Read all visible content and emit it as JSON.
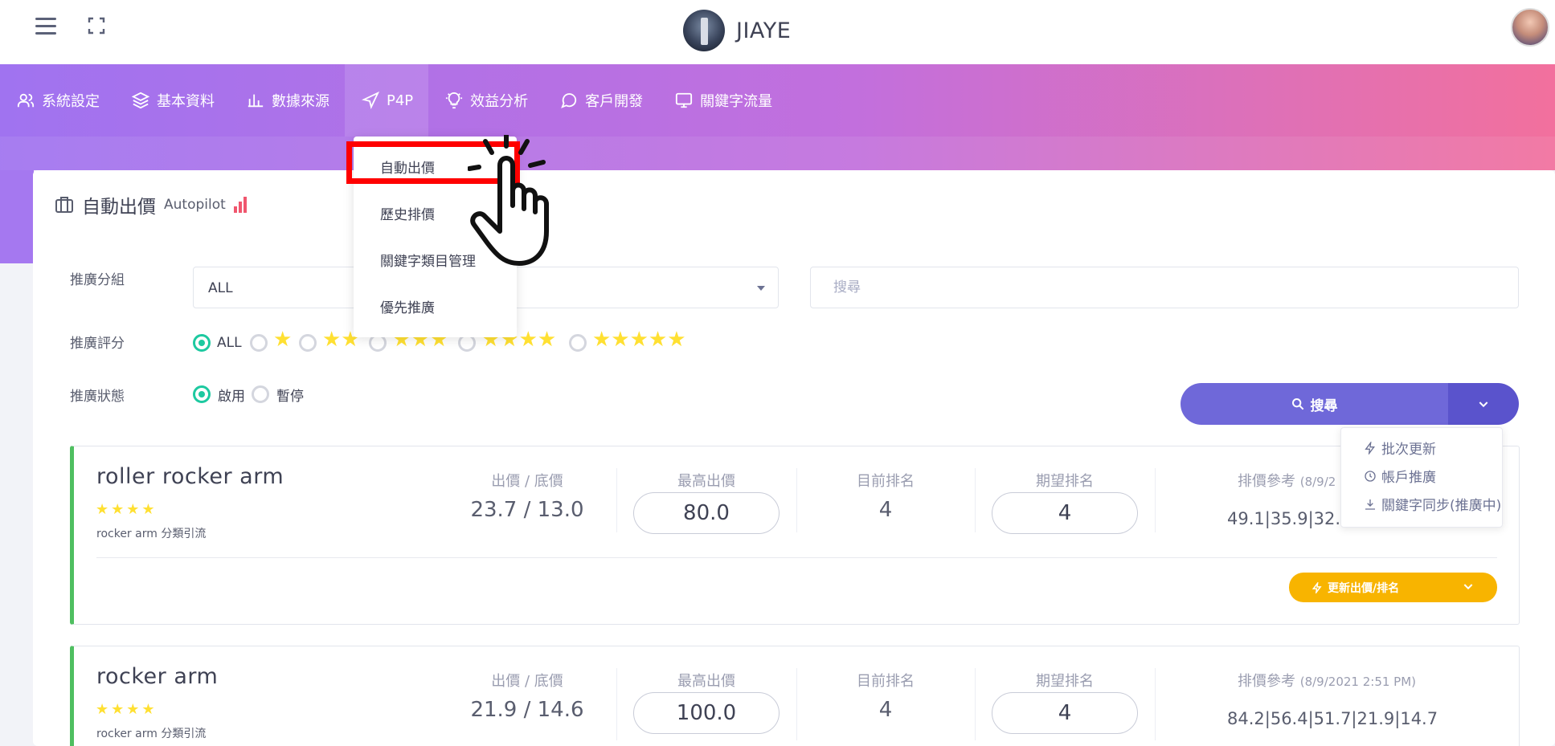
{
  "header": {
    "brand_name": "JIAYE",
    "menu_icon": "hamburger-icon",
    "fullscreen_icon": "expand-icon",
    "avatar_icon": "user-avatar"
  },
  "nav": {
    "items": [
      {
        "label": "系統設定",
        "icon": "users-icon"
      },
      {
        "label": "基本資料",
        "icon": "layers-icon"
      },
      {
        "label": "數據來源",
        "icon": "bar-chart-icon"
      },
      {
        "label": "P4P",
        "icon": "navigation-icon"
      },
      {
        "label": "效益分析",
        "icon": "lightbulb-icon"
      },
      {
        "label": "客戶開發",
        "icon": "chat-icon"
      },
      {
        "label": "關鍵字流量",
        "icon": "monitor-icon"
      }
    ],
    "p4p_dropdown": [
      "自動出價",
      "歷史排價",
      "關鍵字類目管理",
      "優先推廣"
    ]
  },
  "card": {
    "title": "自動出價",
    "subtitle": "Autopilot"
  },
  "filters": {
    "group_label": "推廣分組",
    "group_value": "ALL",
    "search_placeholder": "搜尋",
    "rating_label": "推廣評分",
    "rating_all": "ALL",
    "rating_options": [
      "★",
      "★★",
      "★★★",
      "★★★★",
      "★★★★★"
    ],
    "status_label": "推廣狀態",
    "status_options": [
      "啟用",
      "暫停"
    ]
  },
  "search_button": {
    "label": "搜尋",
    "actions": [
      "批次更新",
      "帳戶推廣",
      "關鍵字同步(推廣中)"
    ]
  },
  "columns": {
    "bid_floor": "出價 / 底價",
    "max_bid": "最高出價",
    "current_rank": "目前排名",
    "target_rank": "期望排名",
    "rank_ref": "排價參考"
  },
  "keywords": [
    {
      "name": "roller rocker arm",
      "stars": "★★★★",
      "category": "rocker arm 分類引流",
      "bid_floor": "23.7 / 13.0",
      "max_bid": "80.0",
      "current_rank": "4",
      "target_rank": "4",
      "ref_date": "(8/9/2",
      "ref_values": "49.1|35.9|32.",
      "update_label": "更新出價/排名"
    },
    {
      "name": "rocker arm",
      "stars": "★★★★",
      "category": "rocker arm 分類引流",
      "bid_floor": "21.9 / 14.6",
      "max_bid": "100.0",
      "current_rank": "4",
      "target_rank": "4",
      "ref_date": "(8/9/2021 2:51 PM)",
      "ref_values": "84.2|56.4|51.7|21.9|14.7"
    }
  ]
}
